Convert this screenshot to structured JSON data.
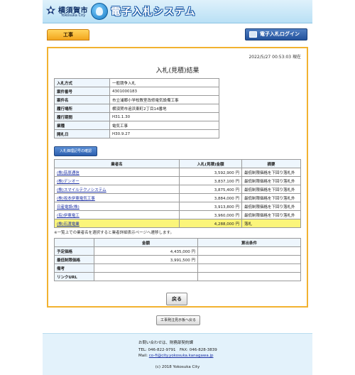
{
  "header": {
    "city_name": "横須賀市",
    "city_name_en": "Yokosuka City",
    "system_title": "電子入札システム"
  },
  "tabs": {
    "active_tab": "工事",
    "login_button": "電子入札ログイン"
  },
  "content": {
    "timestamp": "2022/5/27 00:53:03 現在",
    "heading": "入札(見積)結果",
    "info": [
      {
        "label": "入札方式",
        "value": "一般競争入札"
      },
      {
        "label": "案件番号",
        "value": "4301000183"
      },
      {
        "label": "案件名",
        "value": "市立浦郷小学校教室改修電気設備工事"
      },
      {
        "label": "履行場所",
        "value": "横須賀市追浜東町2丁目14番地"
      },
      {
        "label": "履行期間",
        "value": "H31.1.30"
      },
      {
        "label": "業種",
        "value": "電気工事"
      },
      {
        "label": "開札日",
        "value": "H30.9.27"
      }
    ],
    "confirm_button": "入札価理記号の確認",
    "results_headers": {
      "name": "業者名",
      "amount": "入札(見積)金額",
      "summary": "摘要"
    },
    "results": [
      {
        "name": "(株)荻原通信",
        "amount": "3,592,900 円",
        "summary": "最低制限価格を下回り落札外"
      },
      {
        "name": "(株)デンオー",
        "amount": "3,837,100 円",
        "summary": "最低制限価格を下回り落札外"
      },
      {
        "name": "(株)スマイルテクノシステム",
        "amount": "3,875,400 円",
        "summary": "最低制限価格を下回り落札外"
      },
      {
        "name": "(株)坂本伊東電気工事",
        "amount": "3,884,000 円",
        "summary": "最低制限価格を下回り落札外"
      },
      {
        "name": "日産電設(株)",
        "amount": "3,913,800 円",
        "summary": "最低制限価格を下回り落札外"
      },
      {
        "name": "(有)伊東電工",
        "amount": "3,960,000 円",
        "summary": "最低制限価格を下回り落札外"
      },
      {
        "name": "(株)石渡電業",
        "amount": "4,288,000 円",
        "summary": "落札"
      }
    ],
    "note": "※一覧上での業者名を選択すると業者詳細表示ページへ遷移します。",
    "price_headers": {
      "amount": "金額",
      "condition": "算出条件"
    },
    "prices": [
      {
        "label": "予定価格",
        "amount": "4,435,000 円",
        "condition": ""
      },
      {
        "label": "最低制限価格",
        "amount": "3,991,500 円",
        "condition": ""
      },
      {
        "label": "備考",
        "amount": "",
        "condition": ""
      },
      {
        "label": "リンクURL",
        "amount": "",
        "condition": ""
      }
    ],
    "back_button": "戻る"
  },
  "list_button": "工事発注見示板へ戻る",
  "footer": {
    "contact": "お問い合わせは、財務部契約課",
    "phone": "TEL: 046-822-9791　FAX: 046-828-3839",
    "mail_label": "Mail: ",
    "mail": "co-fi@city.yokosuka.kanagawa.jp",
    "copyright": "(c) 2018 Yokosuka City"
  },
  "colors": {
    "tab_orange": "#f2a51d",
    "frame_border": "#f2b230",
    "login_blue": "#22519c",
    "winner_highlight": "#fbf57a",
    "link_blue": "#1b2fa3",
    "footer_bg": "#e3f2fb"
  }
}
